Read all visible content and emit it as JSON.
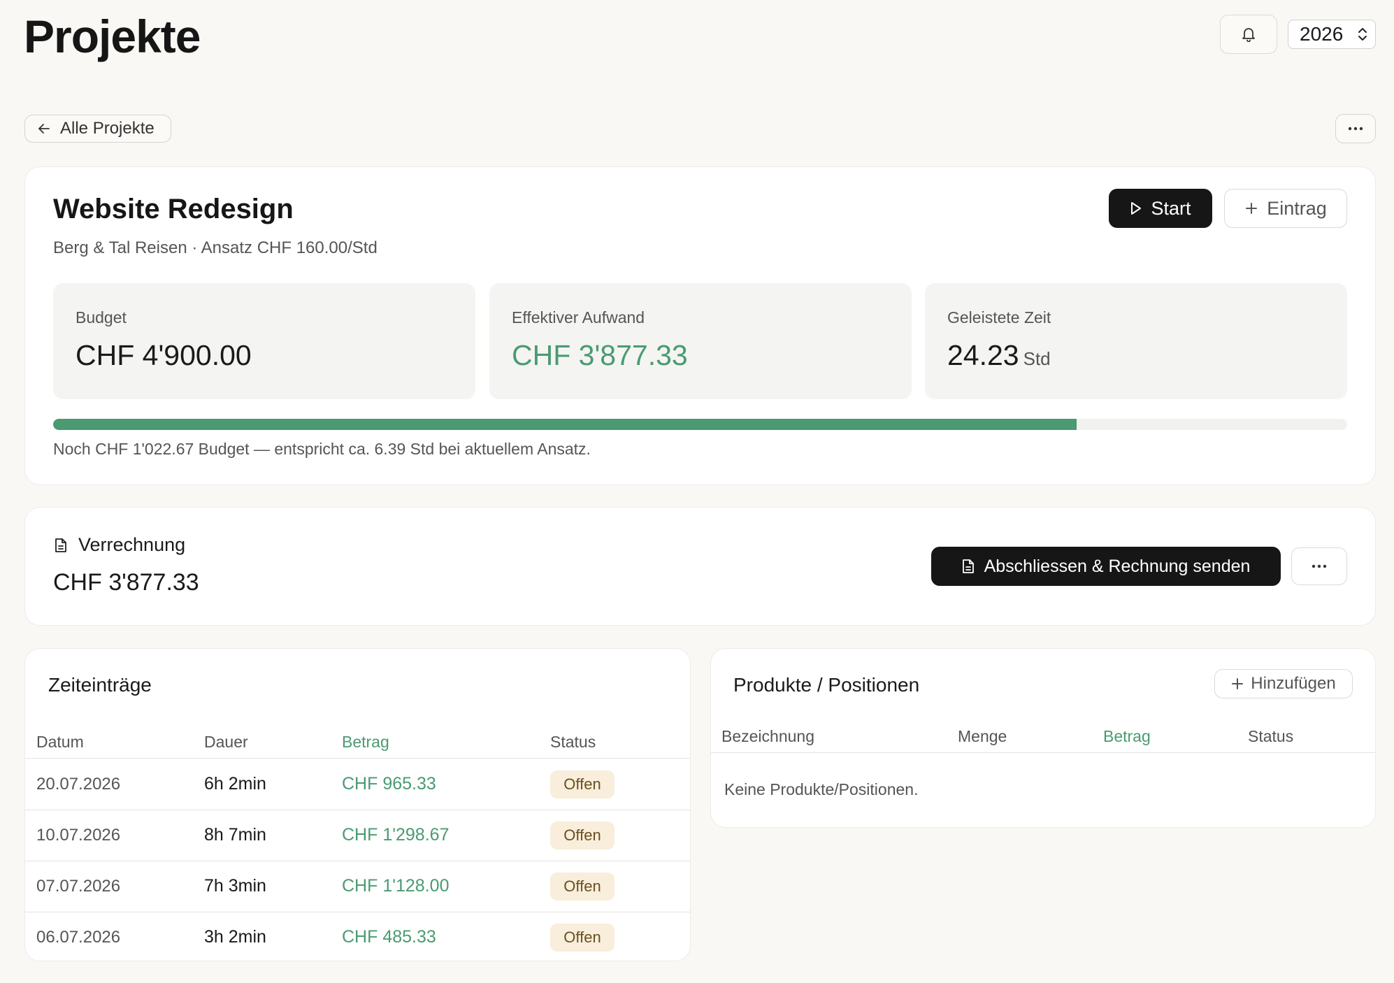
{
  "header": {
    "title": "Projekte",
    "year": "2026",
    "back_label": "Alle Projekte",
    "more_label": "…"
  },
  "project": {
    "name": "Website Redesign",
    "subtitle": "Berg & Tal Reisen · Ansatz CHF 160.00/Std",
    "start_label": "Start",
    "entry_label": "Eintrag",
    "stats": {
      "budget_label": "Budget",
      "budget_value": "CHF 4'900.00",
      "effort_label": "Effektiver Aufwand",
      "effort_value": "CHF 3'877.33",
      "time_label": "Geleistete Zeit",
      "time_value": "24.23",
      "time_unit": "Std"
    },
    "budget_used_percent": 79.1,
    "remaining_note": "Noch CHF 1'022.67 Budget — entspricht ca. 6.39 Std bei aktuellem Ansatz."
  },
  "billing": {
    "title": "Verrechnung",
    "amount": "CHF 3'877.33",
    "invoice_label": "Abschliessen & Rechnung senden",
    "more_label": "…"
  },
  "time_entries": {
    "title": "Zeiteinträge",
    "columns": {
      "date": "Datum",
      "duration": "Dauer",
      "amount": "Betrag",
      "status": "Status"
    },
    "rows": [
      {
        "date": "20.07.2026",
        "duration": "6h 2min",
        "amount": "CHF 965.33",
        "status": "Offen"
      },
      {
        "date": "10.07.2026",
        "duration": "8h 7min",
        "amount": "CHF 1'298.67",
        "status": "Offen"
      },
      {
        "date": "07.07.2026",
        "duration": "7h 3min",
        "amount": "CHF 1'128.00",
        "status": "Offen"
      },
      {
        "date": "06.07.2026",
        "duration": "3h 2min",
        "amount": "CHF 485.33",
        "status": "Offen"
      }
    ]
  },
  "products": {
    "title": "Produkte / Positionen",
    "add_label": "Hinzufügen",
    "columns": {
      "name": "Bezeichnung",
      "quantity": "Menge",
      "amount": "Betrag",
      "status": "Status"
    },
    "empty_text": "Keine Produkte/Positionen."
  },
  "colors": {
    "accent_green": "#4a9a72",
    "dark_button": "#161616",
    "badge_bg": "#f8eedb",
    "badge_text": "#6b4f1f"
  },
  "icons": [
    "bell-icon",
    "chevron-updown-icon",
    "arrow-left-icon",
    "more-icon",
    "play-icon",
    "plus-icon",
    "document-icon"
  ]
}
